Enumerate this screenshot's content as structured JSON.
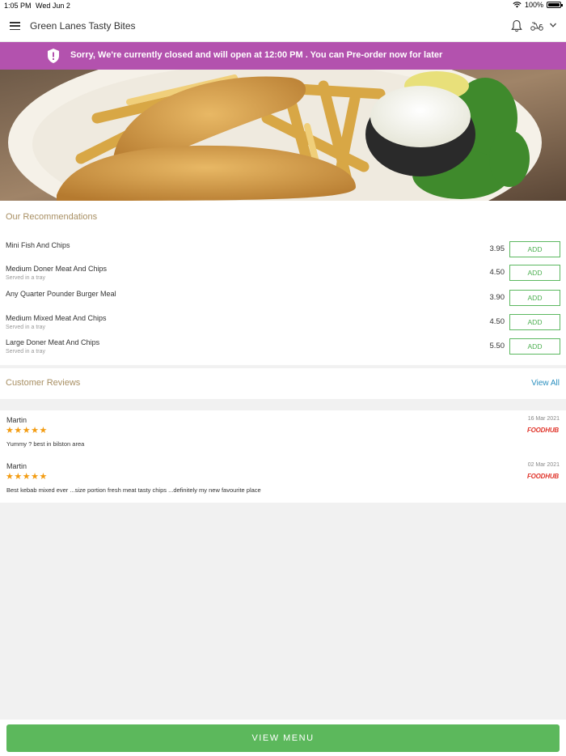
{
  "status_bar": {
    "time": "1:05 PM",
    "date": "Wed Jun 2",
    "battery": "100%"
  },
  "header": {
    "store_name": "Green Lanes Tasty Bites"
  },
  "banner": {
    "message": "Sorry, We're currently closed and will open at 12:00 PM . You can Pre-order now for later",
    "color": "#b352ae"
  },
  "recommendations": {
    "title": "Our Recommendations",
    "add_label": "ADD",
    "items": [
      {
        "name": "Mini Fish And Chips",
        "desc": "",
        "price": "3.95"
      },
      {
        "name": "Medium Doner Meat And Chips",
        "desc": "Served in a tray",
        "price": "4.50"
      },
      {
        "name": "Any Quarter Pounder Burger Meal",
        "desc": "",
        "price": "3.90"
      },
      {
        "name": "Medium Mixed Meat And Chips",
        "desc": "Served in a tray",
        "price": "4.50"
      },
      {
        "name": "Large Doner Meat And Chips",
        "desc": "Served in a tray",
        "price": "5.50"
      }
    ]
  },
  "reviews": {
    "title": "Customer Reviews",
    "view_all": "View All",
    "items": [
      {
        "name": "Martin",
        "stars": "★★★★★",
        "rating": 5,
        "text": "Yummy ? best in bilston area",
        "date": "16 Mar 2021",
        "source": "FOODHUB"
      },
      {
        "name": "Martin",
        "stars": "★★★★★",
        "rating": 5,
        "text": "Best kebab mixed ever ...size portion fresh meat tasty chips ...definitely my new favourite place",
        "date": "02 Mar 2021",
        "source": "FOODHUB"
      }
    ]
  },
  "footer": {
    "view_menu": "VIEW MENU",
    "accent": "#5cb85c"
  }
}
